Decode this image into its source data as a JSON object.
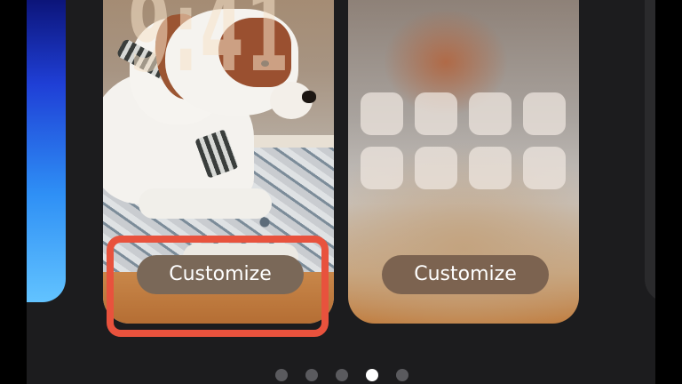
{
  "lock_screen_card": {
    "time": "9:41",
    "customize_label": "Customize"
  },
  "home_screen_card": {
    "app_icon_count": 8,
    "customize_label": "Customize"
  },
  "pager": {
    "pages": 5,
    "current_page": 4
  },
  "colors": {
    "background": "#1c1c1e",
    "highlight_border": "#e8523d",
    "button_bg": "#7a6858",
    "dot_active": "#ffffff",
    "dot_inactive": "#5a5a5e"
  }
}
